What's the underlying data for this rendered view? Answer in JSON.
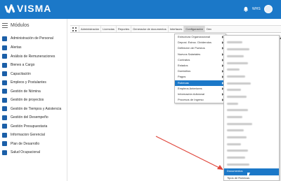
{
  "header": {
    "logo_text": "VISMA",
    "user_initials": "WHS"
  },
  "sidebar": {
    "title": "Módulos",
    "items": [
      {
        "label": "Administración de Personal"
      },
      {
        "label": "Alertas"
      },
      {
        "label": "Análisis de Remuneraciones"
      },
      {
        "label": "Bienes a Cargo"
      },
      {
        "label": "Capacitación"
      },
      {
        "label": "Empleos y Postulantes"
      },
      {
        "label": "Gestión de Nómina"
      },
      {
        "label": "Gestión de proyectos"
      },
      {
        "label": "Gestión de Tiempos y Asistencia"
      },
      {
        "label": "Gestión del Desempeño"
      },
      {
        "label": "Gestión Presupuestaria"
      },
      {
        "label": "Informacion Gerencial"
      },
      {
        "label": "Plan de Desarrollo"
      },
      {
        "label": "Salud Ocupacional"
      }
    ]
  },
  "tabs": [
    {
      "label": "Administración"
    },
    {
      "label": "Licencias"
    },
    {
      "label": "Reportes"
    },
    {
      "label": "Generador de documentos"
    },
    {
      "label": "Interfaces"
    },
    {
      "label": "Configuración",
      "active": true
    },
    {
      "label": "Dev"
    }
  ],
  "config_menu": {
    "items": [
      {
        "label": "Estructura Organizacional",
        "submenu": true
      },
      {
        "label": "Deposi. Estruc. Dividendos",
        "submenu": true
      },
      {
        "label": "Definición de Puestos",
        "submenu": true
      },
      {
        "label": "Nuevos Salariales",
        "submenu": true
      },
      {
        "label": "Contratos",
        "submenu": true
      },
      {
        "label": "Estados",
        "submenu": true
      },
      {
        "label": "Domicilios",
        "submenu": true
      },
      {
        "label": "Pagos",
        "submenu": true
      },
      {
        "label": "Rubecas",
        "submenu": true,
        "selected": true
      },
      {
        "label": "Empleos Anteriores",
        "submenu": true
      },
      {
        "label": "Información Adicional",
        "submenu": true
      },
      {
        "label": "Procesos de Ingreso",
        "submenu": true
      }
    ]
  },
  "sub_menu": {
    "highlighted_label": "Documentos",
    "last_label": "Tipos de Rubecas"
  },
  "colors": {
    "header_blue": "#1b78c8",
    "selected_blue": "#1b78c8",
    "annotation_red": "#e0453a"
  }
}
